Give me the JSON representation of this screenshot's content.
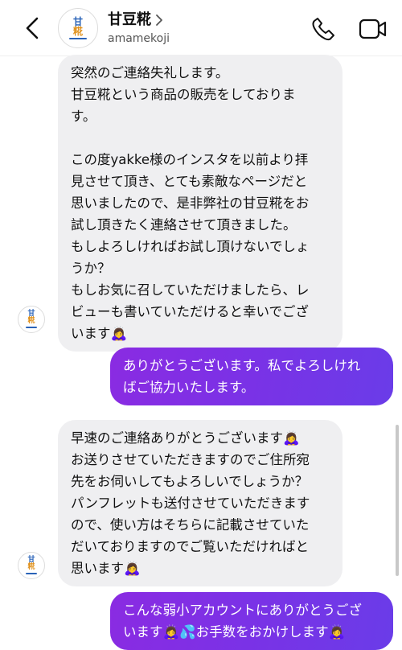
{
  "header": {
    "name": "甘豆糀",
    "username": "amamekoji",
    "logo_top": "甘",
    "logo_bottom": "糀"
  },
  "messages": [
    {
      "direction": "incoming",
      "lines": [
        "突然のご連絡失礼します。",
        "甘豆糀という商品の販売をしておりま",
        "す。",
        "",
        "この度yakke様のインスタを以前より拝",
        "見させて頂き、とても素敵なページだと",
        "思いましたので、是非弊社の甘豆糀をお",
        "試し頂きたく連絡させて頂きました。",
        "もしよろしければお試し頂けないでしょ",
        "うか？",
        "もしお気に召していただけましたら、レ",
        "ビューも書いていただけると幸いでござ",
        "います🙇‍♀️"
      ]
    },
    {
      "direction": "outgoing",
      "lines": [
        "ありがとうございます。私でよろしけれ",
        "ばご協力いたします。"
      ]
    },
    {
      "direction": "incoming",
      "lines": [
        "早速のご連絡ありがとうございます🙇‍♀️",
        "お送りさせていただきますのでご住所宛",
        "先をお伺いしてもよろしいでしょうか？",
        "パンフレットも送付させていただきます",
        "ので、使い方はそちらに記載させていた",
        "だいておりますのでご覧いただければと",
        "思います🙇‍♀️"
      ]
    },
    {
      "direction": "outgoing",
      "lines": [
        "こんな弱小アカウントにありがとうござ",
        "います🙇‍♀️💦お手数をおかけします🙇‍♀️"
      ]
    }
  ],
  "colors": {
    "incoming_bubble": "#efeff1",
    "outgoing_start": "#8a2be2",
    "outgoing_end": "#6a3ce8",
    "logo_blue": "#2a63b8",
    "logo_orange": "#e0921e"
  },
  "icons": [
    "back-chevron-icon",
    "chevron-right-icon",
    "phone-icon",
    "video-camera-icon"
  ]
}
